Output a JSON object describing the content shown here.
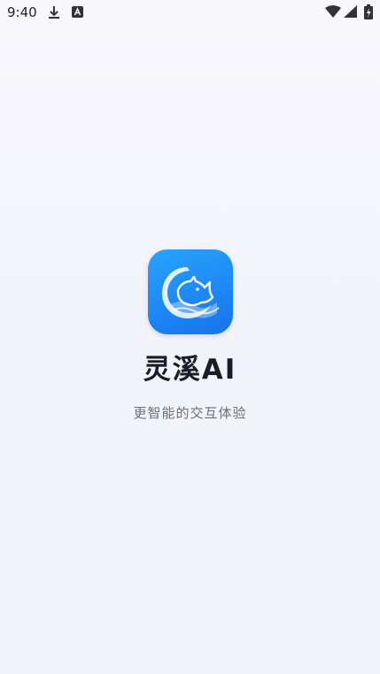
{
  "status_bar": {
    "time": "9:40",
    "icons": [
      "download-icon",
      "a-icon",
      "wifi-icon",
      "signal-icon",
      "battery-icon"
    ]
  },
  "splash": {
    "app_name": "灵溪AI",
    "tagline": "更智能的交互体验",
    "icon": "rhino-logo-icon",
    "colors": {
      "icon_gradient_top": "#28a4ff",
      "icon_gradient_bottom": "#1673ea",
      "background": "#f3f3fb"
    }
  }
}
